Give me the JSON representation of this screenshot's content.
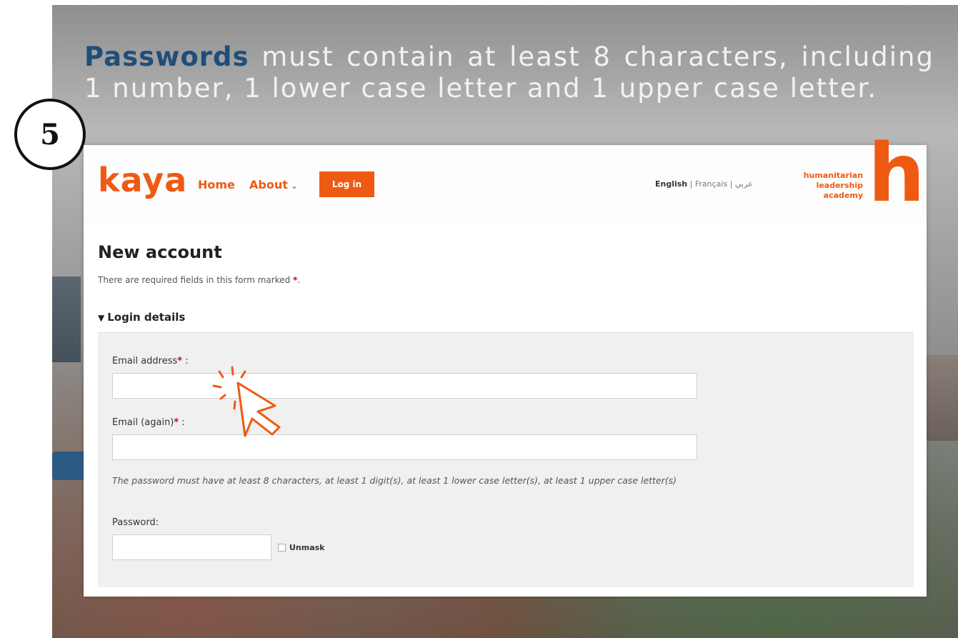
{
  "banner": {
    "highlight": "Passwords",
    "text": " must contain at least 8 characters, including 1 number, 1 lower case letter and 1 upper case letter."
  },
  "step_number": "5",
  "site": {
    "logo": "kaya",
    "nav": {
      "home": "Home",
      "about": "About",
      "login_button": "Log in"
    },
    "languages": {
      "active": "English",
      "others": [
        "Français",
        "عربي"
      ]
    },
    "partner": {
      "line1": "humanitarian",
      "line2": "leadership",
      "line3": "academy",
      "mark": "h"
    },
    "page_title": "New account",
    "required_note": "There are required fields in this form marked",
    "required_mark": "*",
    "section_title": "Login details",
    "form": {
      "email_label": "Email address",
      "email_value": "",
      "email_again_label": "Email (again)",
      "email_again_value": "",
      "password_help": "The password must have at least 8 characters, at least 1 digit(s), at least 1 lower case letter(s), at least 1 upper case letter(s)",
      "password_label": "Password:",
      "password_value": "",
      "unmask_label": "Unmask"
    }
  },
  "colors": {
    "brand_orange": "#ef5a12",
    "banner_highlight": "#1f4e79",
    "required_red": "#d0021b"
  }
}
